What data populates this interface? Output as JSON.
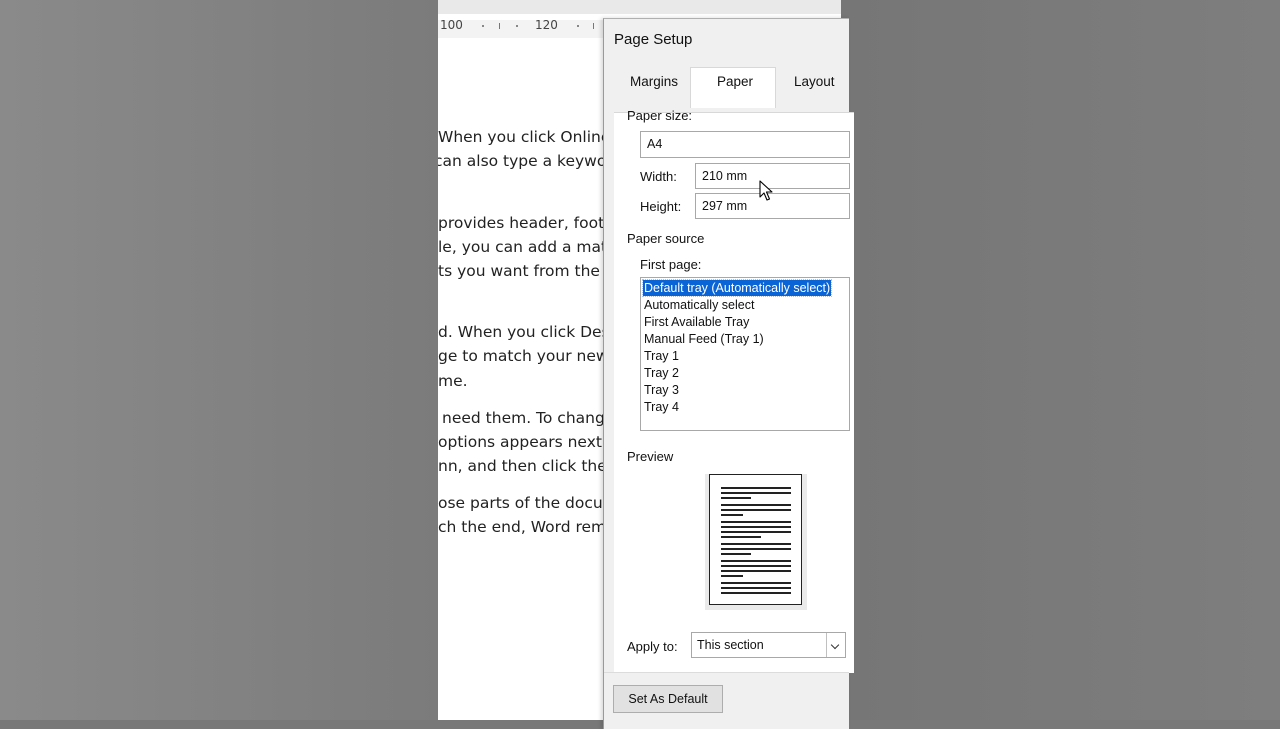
{
  "document": {
    "ruler_labels": [
      "100",
      "120"
    ],
    "paragraphs": [
      "When you click Online",
      "can also type a keyword",
      "provides header, foote",
      "le, you can add a matc",
      "ts you want from the d",
      "d. When you click Desig",
      "ge to match your new t",
      "me.",
      "need them. To change",
      "options appears next to",
      "nn, and then click the p",
      "ose parts of the docum",
      "ch the end, Word reme"
    ]
  },
  "dialog": {
    "title": "Page Setup",
    "tabs": [
      {
        "label": "Margins",
        "active": false
      },
      {
        "label": "Paper",
        "active": true
      },
      {
        "label": "Layout",
        "active": false
      }
    ],
    "paper_size": {
      "label": "Paper size:",
      "value": "A4",
      "width_label": "Width:",
      "width_value": "210 mm",
      "height_label": "Height:",
      "height_value": "297 mm"
    },
    "paper_source": {
      "label": "Paper source",
      "first_page_label": "First page:",
      "options": [
        "Default tray (Automatically select)",
        "Automatically select",
        "First Available Tray",
        "Manual Feed (Tray 1)",
        "Tray 1",
        "Tray 2",
        "Tray 3",
        "Tray 4"
      ],
      "selected_index": 0
    },
    "preview": {
      "label": "Preview"
    },
    "apply_to": {
      "label": "Apply to:",
      "value": "This section"
    },
    "set_default_button": "Set As Default"
  },
  "colors": {
    "selection": "#0a64d6",
    "dialog_bg": "#f0f0f0",
    "outside_bg": "#7b7b7b"
  }
}
